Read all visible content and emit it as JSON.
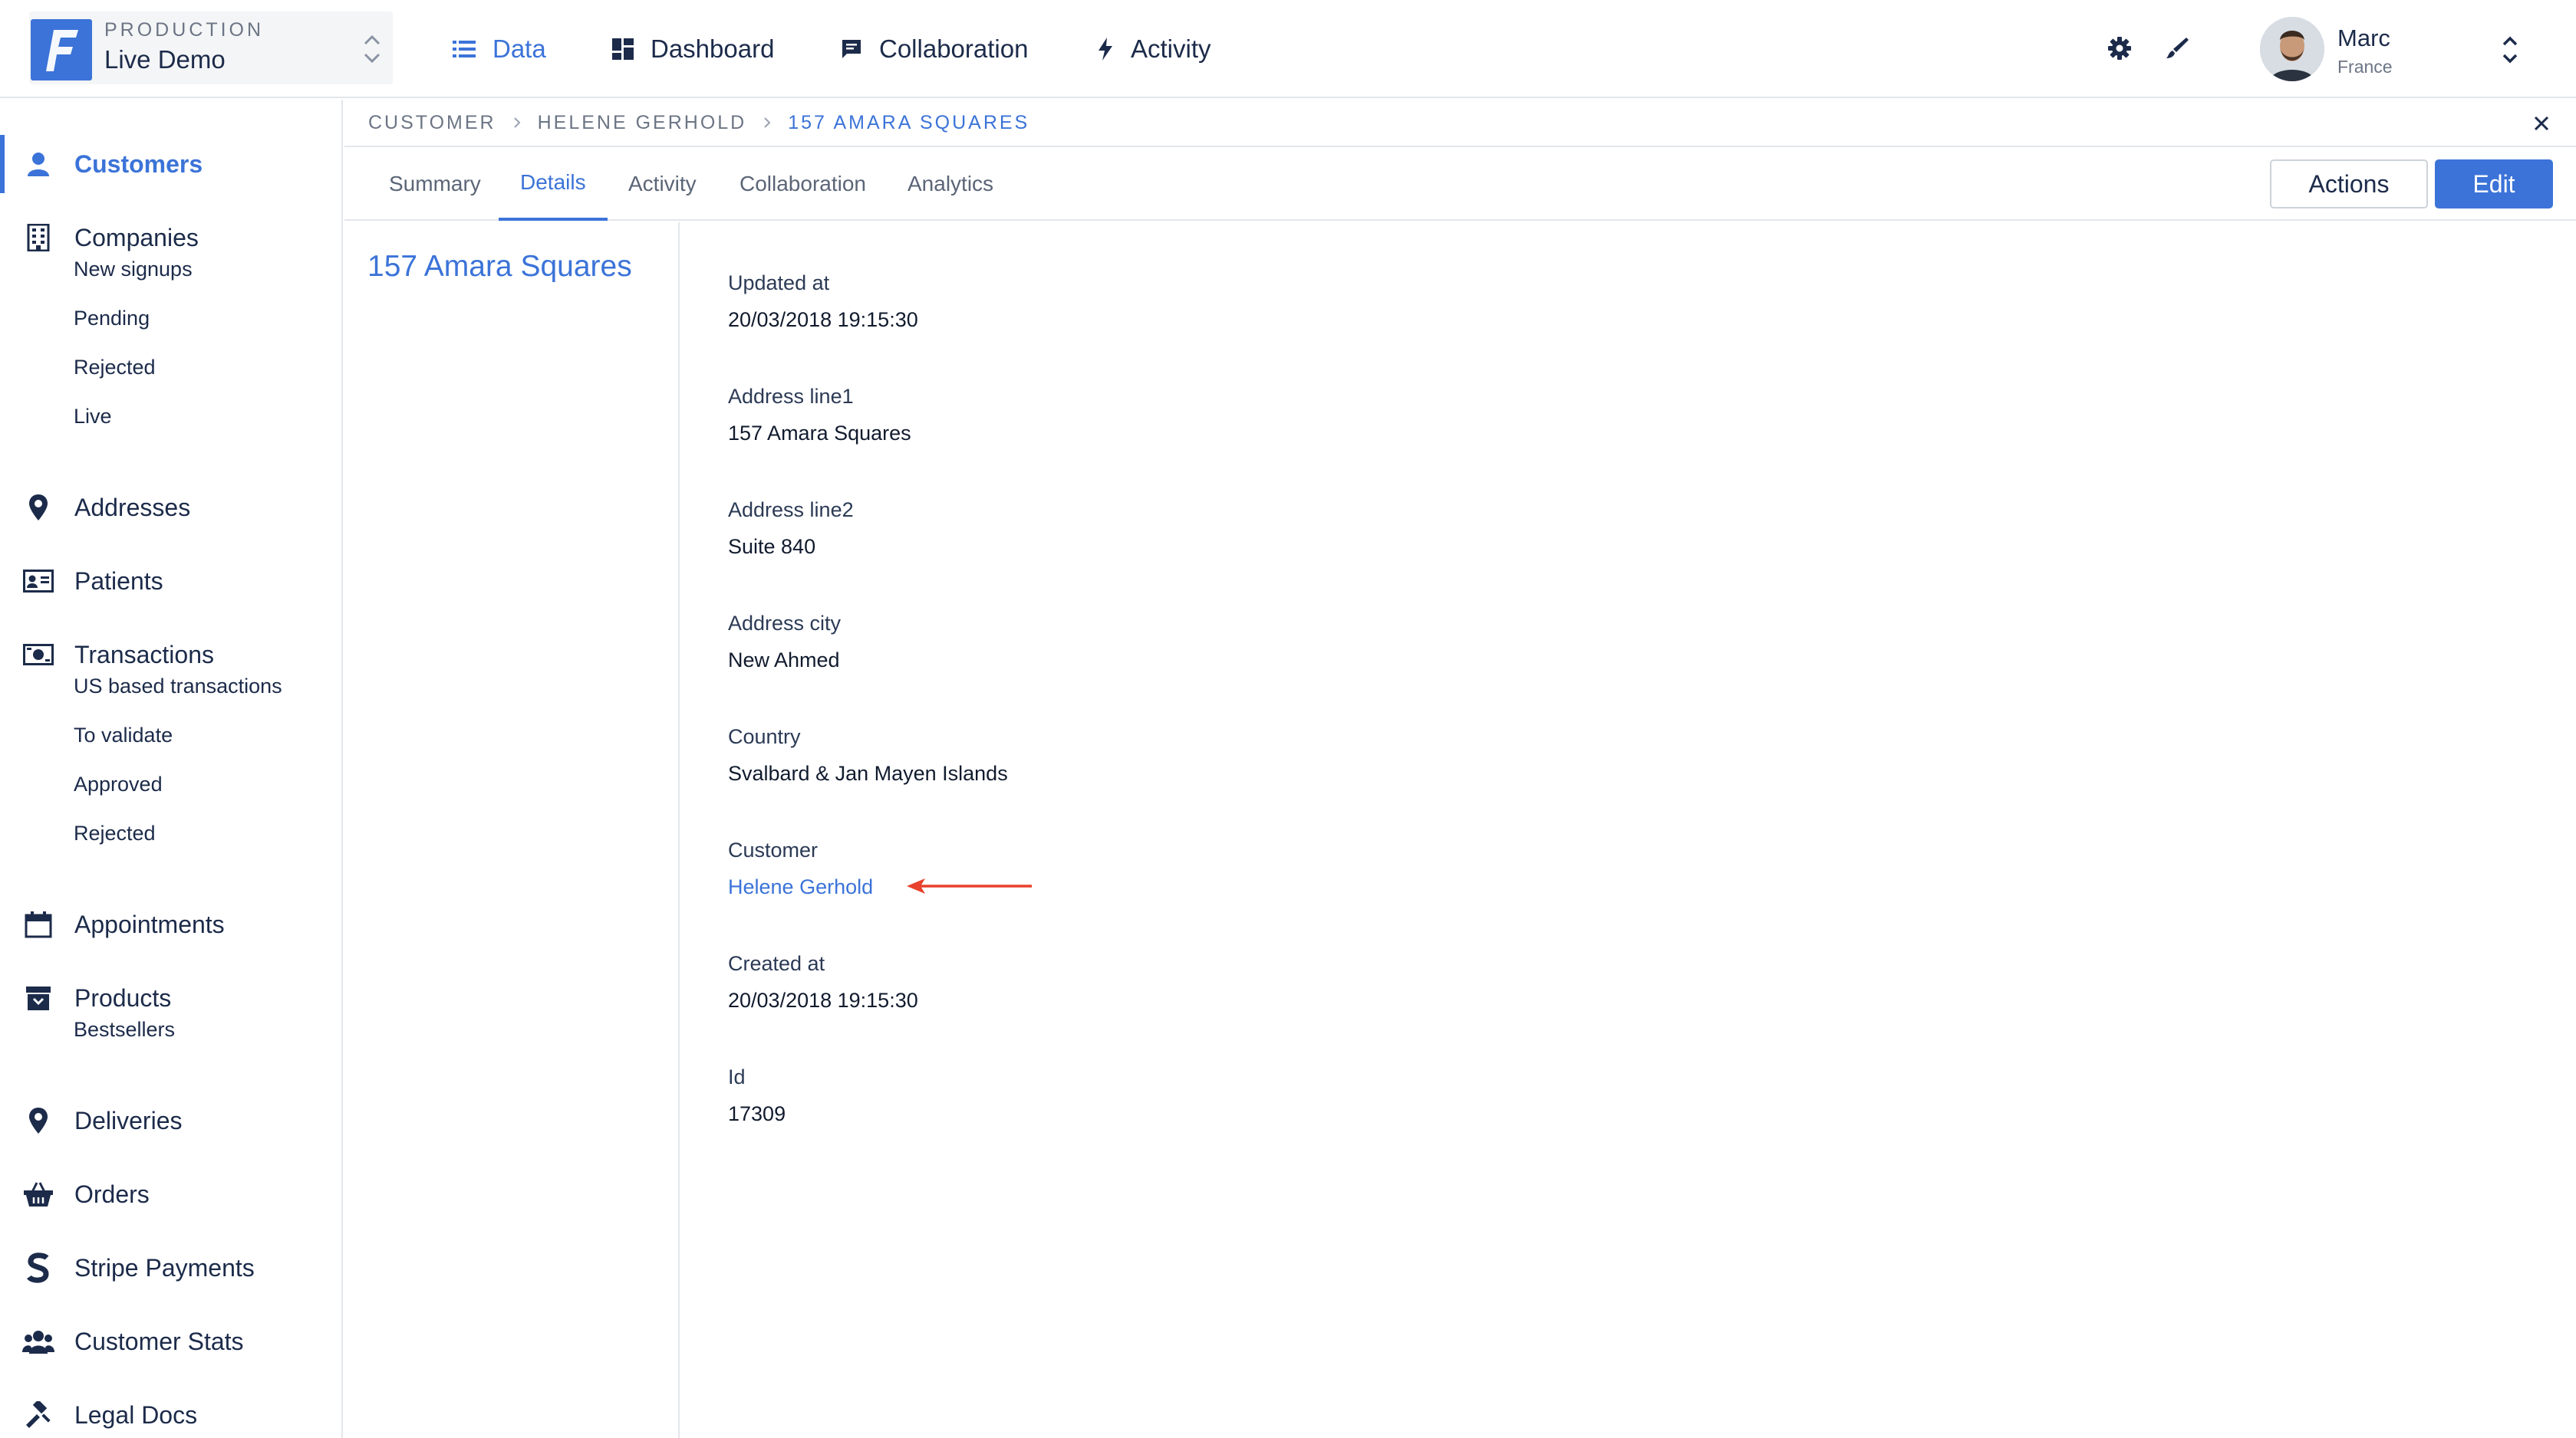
{
  "env": {
    "label": "PRODUCTION",
    "name": "Live Demo"
  },
  "topnav": [
    {
      "label": "Data",
      "icon": "list-icon"
    },
    {
      "label": "Dashboard",
      "icon": "dashboard-icon"
    },
    {
      "label": "Collaboration",
      "icon": "chat-icon"
    },
    {
      "label": "Activity",
      "icon": "bolt-icon"
    }
  ],
  "user": {
    "name": "Marc",
    "country": "France"
  },
  "sidebar": {
    "items": [
      {
        "label": "Customers",
        "icon": "user-icon"
      },
      {
        "label": "Companies",
        "icon": "building-icon"
      },
      {
        "label": "Addresses",
        "icon": "map-pin-icon"
      },
      {
        "label": "Patients",
        "icon": "id-card-icon"
      },
      {
        "label": "Transactions",
        "icon": "banknote-icon"
      },
      {
        "label": "Appointments",
        "icon": "calendar-icon"
      },
      {
        "label": "Products",
        "icon": "archive-icon"
      },
      {
        "label": "Deliveries",
        "icon": "map-pin-icon"
      },
      {
        "label": "Orders",
        "icon": "basket-icon"
      },
      {
        "label": "Stripe Payments",
        "icon": "stripe-icon"
      },
      {
        "label": "Customer Stats",
        "icon": "users-icon"
      },
      {
        "label": "Legal Docs",
        "icon": "gavel-icon"
      }
    ],
    "companies_sub": [
      "New signups",
      "Pending",
      "Rejected",
      "Live"
    ],
    "transactions_sub": [
      "US based transactions",
      "To validate",
      "Approved",
      "Rejected"
    ],
    "products_sub": [
      "Bestsellers"
    ]
  },
  "breadcrumb": [
    "CUSTOMER",
    "HELENE GERHOLD",
    "157 AMARA SQUARES"
  ],
  "tabs": [
    "Summary",
    "Details",
    "Activity",
    "Collaboration",
    "Analytics"
  ],
  "buttons": {
    "actions": "Actions",
    "edit": "Edit"
  },
  "record": {
    "title": "157 Amara Squares"
  },
  "fields": [
    {
      "label": "Updated at",
      "value": "20/03/2018 19:15:30"
    },
    {
      "label": "Address line1",
      "value": "157 Amara Squares"
    },
    {
      "label": "Address line2",
      "value": "Suite 840"
    },
    {
      "label": "Address city",
      "value": "New Ahmed"
    },
    {
      "label": "Country",
      "value": "Svalbard & Jan Mayen Islands"
    },
    {
      "label": "Customer",
      "value": "Helene Gerhold"
    },
    {
      "label": "Created at",
      "value": "20/03/2018 19:15:30"
    },
    {
      "label": "Id",
      "value": "17309"
    }
  ],
  "colors": {
    "accent": "#3b73d8",
    "arrow": "#e8412c",
    "text": "#1c2b4a"
  }
}
